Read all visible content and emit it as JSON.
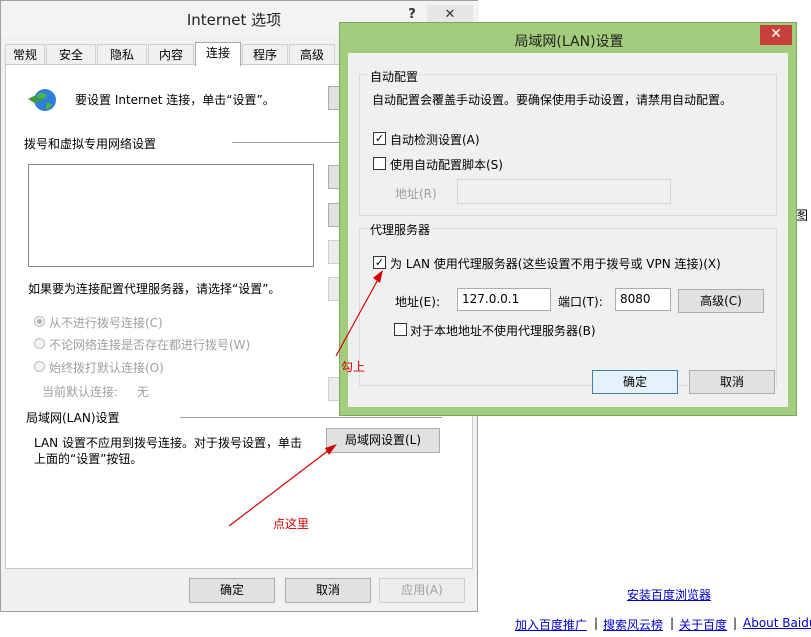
{
  "browser": {
    "link_install": "安装百度浏览器",
    "footer_links": [
      "加入百度推广",
      "搜索风云榜",
      "关于百度",
      "About Baidu"
    ],
    "footer_sep": "|",
    "edge_fragment": "图"
  },
  "io": {
    "title": "Internet 选项",
    "help_label": "?",
    "close_label": "✕",
    "tabs": [
      "常规",
      "安全",
      "隐私",
      "内容",
      "连接",
      "程序",
      "高级"
    ],
    "setup_text": "要设置 Internet 连接，单击“设置”。",
    "dialup_heading": "拨号和虚拟专用网络设置",
    "proxy_hint": "如果要为连接配置代理服务器，请选择“设置”。",
    "radio_options": [
      "从不进行拨号连接(C)",
      "不论网络连接是否存在都进行拨号(W)",
      "始终拨打默认连接(O)"
    ],
    "current_default_label": "当前默认连接:",
    "current_default_value": "无",
    "lan_heading": "局域网(LAN)设置",
    "lan_desc_line1": "LAN 设置不应用到拨号连接。对于拨号设置，单击",
    "lan_desc_line2": "上面的“设置”按钮。",
    "lan_button": "局域网设置(L)",
    "ok": "确定",
    "cancel": "取消",
    "apply": "应用(A)"
  },
  "lan": {
    "title": "局域网(LAN)设置",
    "close_label": "✕",
    "auto_group": "自动配置",
    "auto_desc": "自动配置会覆盖手动设置。要确保使用手动设置，请禁用自动配置。",
    "auto_detect": "自动检测设置(A)",
    "auto_script": "使用自动配置脚本(S)",
    "address_label_disabled": "地址(R)",
    "proxy_group": "代理服务器",
    "use_proxy": "为 LAN 使用代理服务器(这些设置不用于拨号或 VPN 连接)(X)",
    "address_label": "地址(E):",
    "address_value": "127.0.0.1",
    "port_label": "端口(T):",
    "port_value": "8080",
    "advanced": "高级(C)",
    "bypass_local": "对于本地地址不使用代理服务器(B)",
    "ok": "确定",
    "cancel": "取消",
    "check_mark": "✓"
  },
  "annotations": {
    "check_here": "勾上",
    "click_here": "点这里",
    "color": "#d40000"
  }
}
